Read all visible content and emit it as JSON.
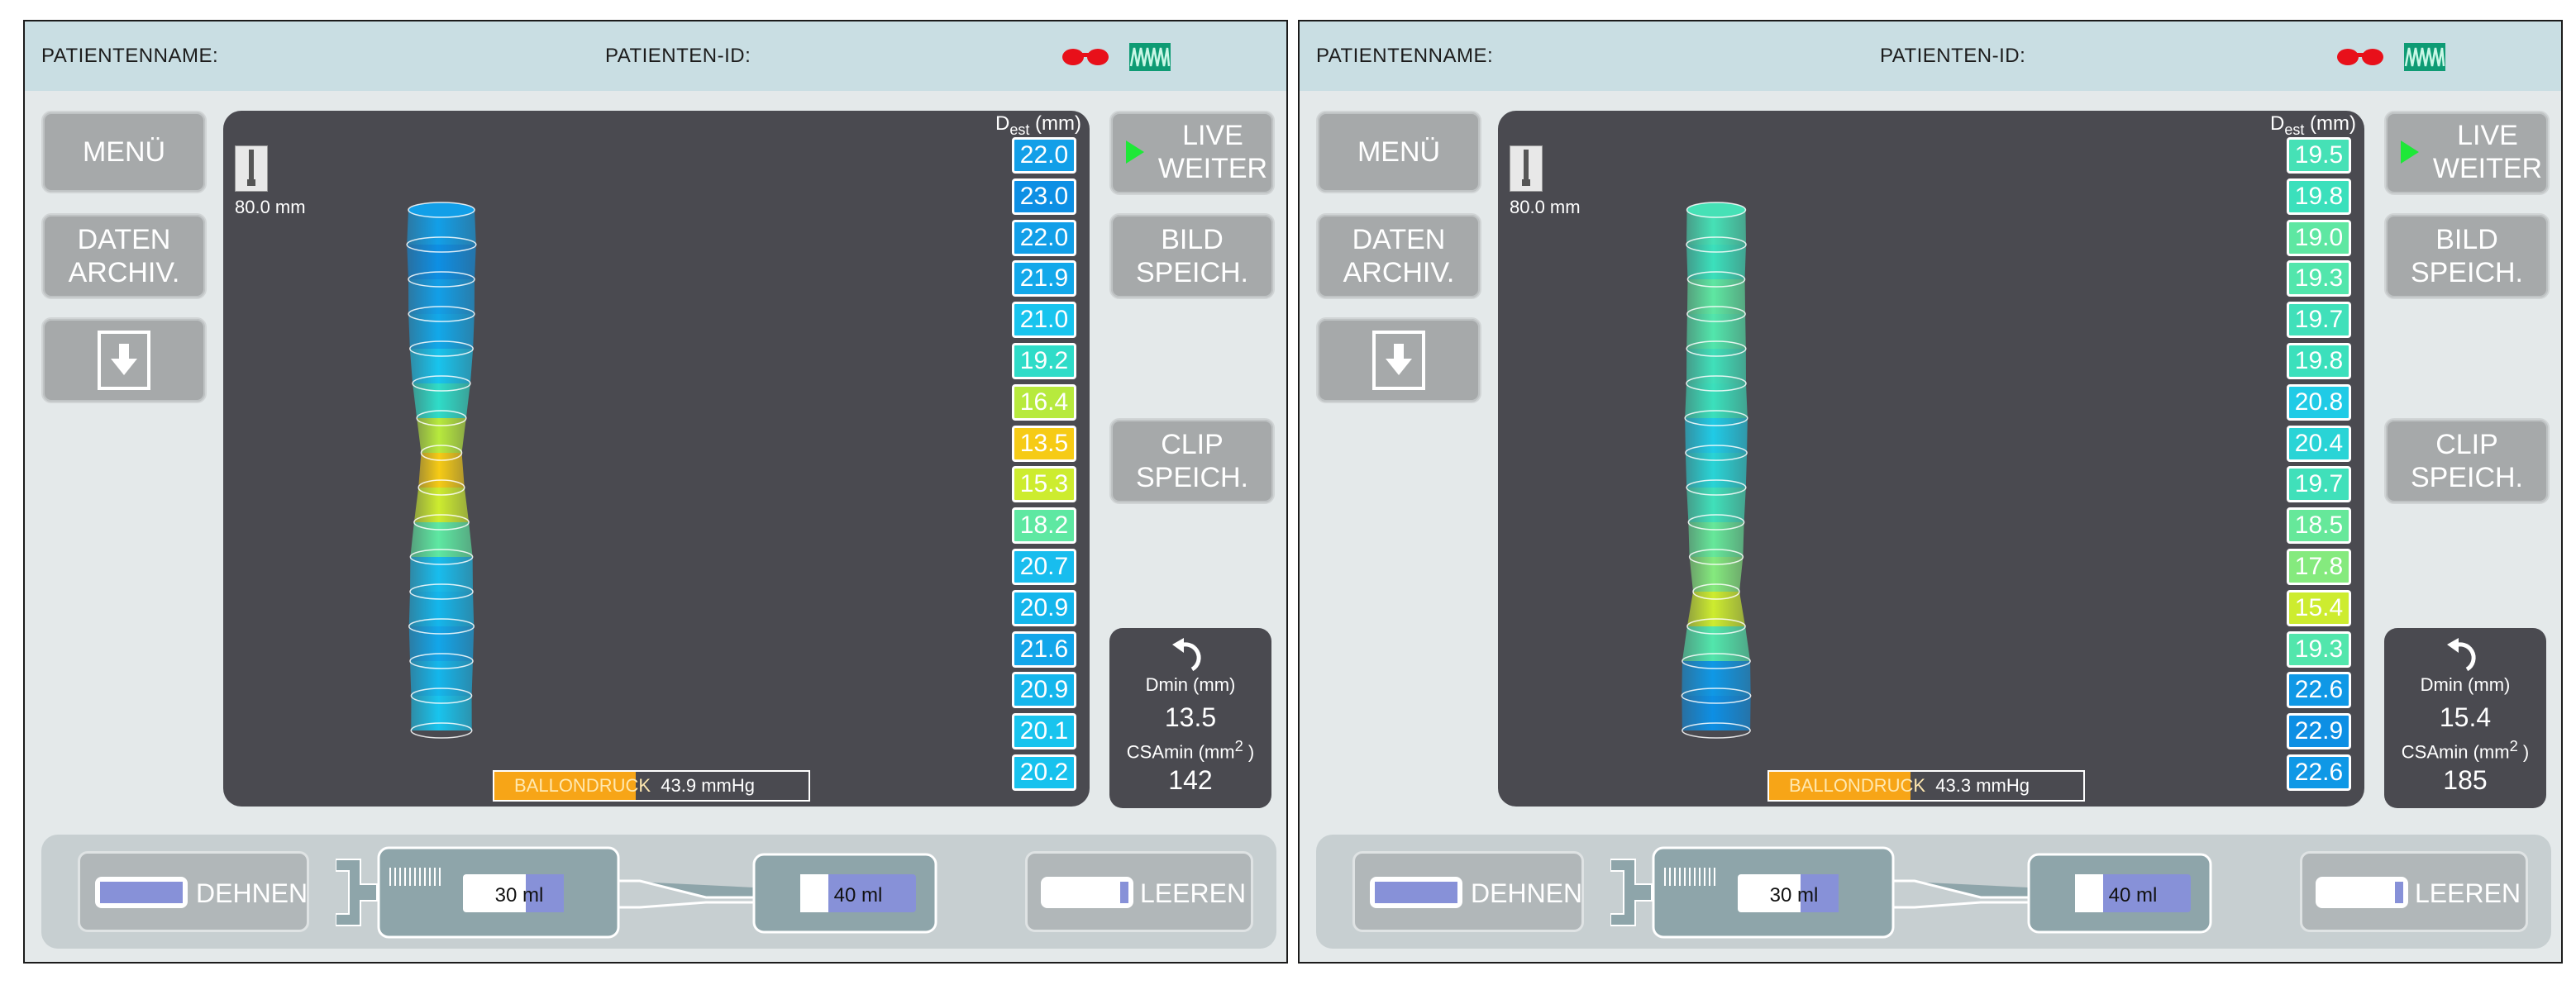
{
  "screens": [
    {
      "header": {
        "patient_name_label": "PATIENTENNAME:",
        "patient_id_label": "PATIENTEN-ID:"
      },
      "menu": {
        "menu_label": "MENÜ",
        "daten_label": "DATEN\nARCHIV.",
        "download_icon": "download-icon"
      },
      "actions": {
        "live_label": "LIVE\nWEITER",
        "bild_label": "BILD\nSPEICH.",
        "clip_label": "CLIP\nSPEICH."
      },
      "viewer": {
        "probe_label": "80.0 mm",
        "dest_label": "D",
        "dest_sub": "est",
        "dest_unit": " (mm)",
        "dest_values": [
          "22.0",
          "23.0",
          "22.0",
          "21.9",
          "21.0",
          "19.2",
          "16.4",
          "13.5",
          "15.3",
          "18.2",
          "20.7",
          "20.9",
          "21.6",
          "20.9",
          "20.1",
          "20.2"
        ],
        "dest_colors": [
          "#129fe8",
          "#0d8fe4",
          "#129fe8",
          "#12a8ea",
          "#18c4ee",
          "#2fdcc8",
          "#b7ea3d",
          "#f6cb15",
          "#cdec2f",
          "#5ee8a2",
          "#18bdee",
          "#14b6ec",
          "#12a6ea",
          "#14b6ec",
          "#18c4ee",
          "#17c2ee"
        ],
        "pressure_label": "BALLONDRUCK",
        "pressure_value": "43.9 mmHg",
        "pressure_fill": 0.45
      },
      "stats": {
        "dmin_label": "Dmin (mm)",
        "dmin_value": "13.5",
        "csamin_label": "CSAmin (mm",
        "csamin_sup": "2",
        "csamin_close": " )",
        "csamin_value": "142"
      },
      "pump": {
        "dehnen_label": "DEHNEN",
        "leeren_label": "LEEREN",
        "syringe_volume": "30 ml",
        "reservoir_volume": "40 ml"
      }
    },
    {
      "header": {
        "patient_name_label": "PATIENTENNAME:",
        "patient_id_label": "PATIENTEN-ID:"
      },
      "menu": {
        "menu_label": "MENÜ",
        "daten_label": "DATEN\nARCHIV.",
        "download_icon": "download-icon"
      },
      "actions": {
        "live_label": "LIVE\nWEITER",
        "bild_label": "BILD\nSPEICH.",
        "clip_label": "CLIP\nSPEICH."
      },
      "viewer": {
        "probe_label": "80.0 mm",
        "dest_label": "D",
        "dest_sub": "est",
        "dest_unit": " (mm)",
        "dest_values": [
          "19.5",
          "19.8",
          "19.0",
          "19.3",
          "19.7",
          "19.8",
          "20.8",
          "20.4",
          "19.7",
          "18.5",
          "17.8",
          "15.4",
          "19.3",
          "22.6",
          "22.9",
          "22.6"
        ],
        "dest_colors": [
          "#46e1b6",
          "#3be0bc",
          "#5ee7a2",
          "#52e6ac",
          "#40e0ba",
          "#3be0bc",
          "#20cbe6",
          "#29d4d6",
          "#40e0ba",
          "#66e89a",
          "#85ea7e",
          "#cdec2f",
          "#52e6ac",
          "#0f98e6",
          "#0d8fe4",
          "#0f98e6"
        ],
        "pressure_label": "BALLONDRUCK",
        "pressure_value": "43.3 mmHg",
        "pressure_fill": 0.45
      },
      "stats": {
        "dmin_label": "Dmin (mm)",
        "dmin_value": "15.4",
        "csamin_label": "CSAmin (mm",
        "csamin_sup": "2",
        "csamin_close": " )",
        "csamin_value": "185"
      },
      "pump": {
        "dehnen_label": "DEHNEN",
        "leeren_label": "LEEREN",
        "syringe_volume": "30 ml",
        "reservoir_volume": "40 ml"
      }
    }
  ]
}
